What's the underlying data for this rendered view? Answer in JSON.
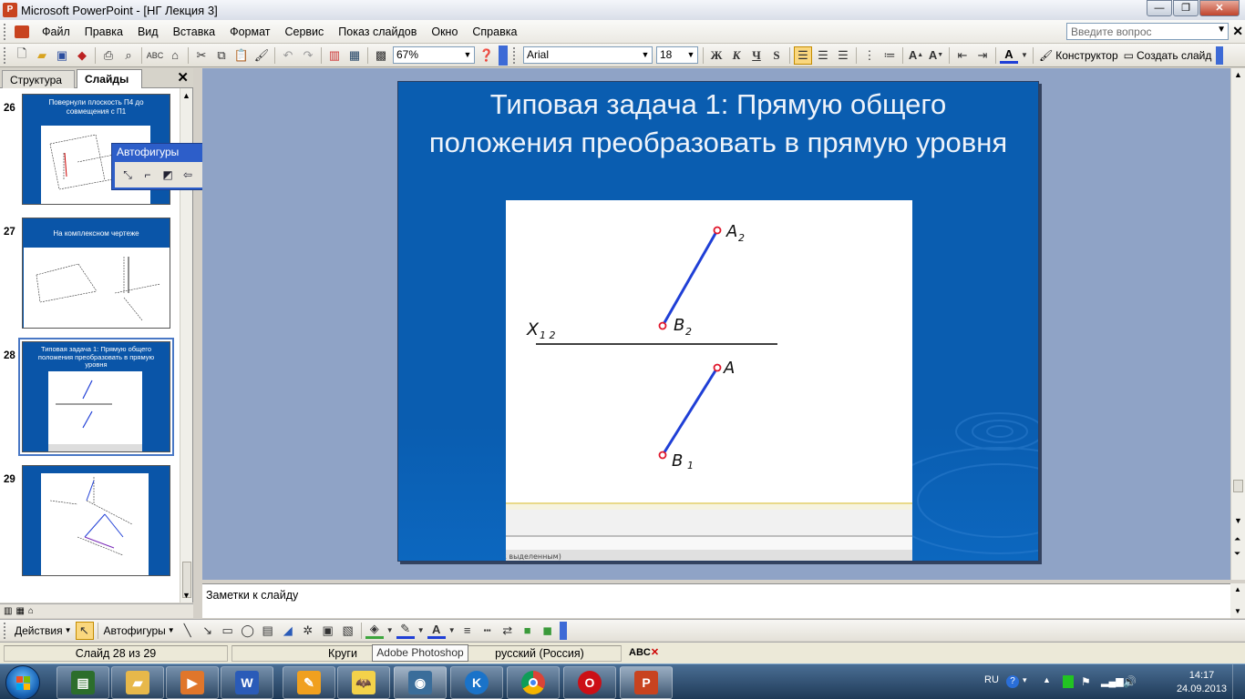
{
  "window": {
    "title": "Microsoft PowerPoint - [НГ Лекция 3]",
    "min": "—",
    "restore": "❐",
    "close": "✕"
  },
  "menu": {
    "items": [
      "Файл",
      "Правка",
      "Вид",
      "Вставка",
      "Формат",
      "Сервис",
      "Показ слайдов",
      "Окно",
      "Справка"
    ],
    "help_placeholder": "Введите вопрос",
    "close": "✕"
  },
  "toolbar": {
    "zoom": "67%",
    "font": "Arial",
    "size": "18",
    "bold": "Ж",
    "italic": "К",
    "underline": "Ч",
    "shadow": "S",
    "designer": "Конструктор",
    "new_slide": "Создать слайд"
  },
  "left_panel": {
    "tab_structure": "Структура",
    "tab_slides": "Слайды",
    "close": "✕",
    "slides": [
      {
        "num": "26",
        "title": "Повернули плоскость П4 до совмещения с П1"
      },
      {
        "num": "27",
        "title": "На комплексном чертеже"
      },
      {
        "num": "28",
        "title": "Типовая задача 1: Прямую общего положения преобразовать в прямую уровня"
      },
      {
        "num": "29",
        "title": ""
      }
    ]
  },
  "autoshapes_toolbar": {
    "title": "Автофигуры",
    "dropdown": "▼",
    "close": "✕"
  },
  "slide": {
    "title": "Типовая задача 1: Прямую общего положения преобразовать в прямую уровня",
    "labels": {
      "a2": "A",
      "a2_sub": "2",
      "b2": "B",
      "b2_sub": "2",
      "x12": "X",
      "x12_sub": "1 2",
      "a": "A",
      "b1": "B",
      "b1_sub": "1"
    },
    "bottom_caption": "к выделенным)"
  },
  "notes": {
    "placeholder": "Заметки к слайду"
  },
  "drawing_toolbar": {
    "actions": "Действия",
    "autoshapes": "Автофигуры"
  },
  "status": {
    "slide": "Слайд 28 из 29",
    "design": "Круги",
    "tooltip": "Adobe Photoshop",
    "language": "русский (Россия)"
  },
  "taskbar": {
    "lang": "RU",
    "time": "14:17",
    "date": "24.09.2013"
  },
  "colors": {
    "slide_bg": "#0a5db0",
    "segment": "#1f3fd6",
    "point": "#e0162b"
  }
}
